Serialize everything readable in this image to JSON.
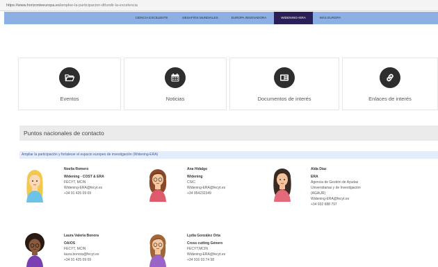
{
  "browser": {
    "url_host": "https://www.horizonteeuropa.es/",
    "url_path": "ampliar-la-participacion-difundir-la-excelencia"
  },
  "nav": {
    "items": [
      {
        "label": "CIENCIA EXCELENTE"
      },
      {
        "label": "DESAFÍOS MUNDIALES"
      },
      {
        "label": "EUROPA INNOVADORA"
      },
      {
        "label": "WIDENING+ERA"
      },
      {
        "label": "MÁS EUROPA"
      }
    ]
  },
  "cards": [
    {
      "label": "Eventos",
      "icon": "folder-open-icon"
    },
    {
      "label": "Noticias",
      "icon": "calendar-icon"
    },
    {
      "label": "Documentos de interés",
      "icon": "newspaper-icon"
    },
    {
      "label": "Enlaces de interés",
      "icon": "link-icon"
    }
  ],
  "section": {
    "title": "Puntos nacionales de contacto",
    "subtitle": "Ampliar la participación y fortalecer el espacio europeo de investigación (Widening-ERA)"
  },
  "contacts": [
    {
      "name": "Noelia Romero",
      "role": "Widening - COST & ERA",
      "lines": [
        "FECYT, MCIN",
        "Widening-ERA@fecyt.es",
        "+34 91 425 09 09"
      ]
    },
    {
      "name": "Ana Hidalgo",
      "role": "Widening",
      "lines": [
        "CSIC",
        "Widening-ERA@fecyt.es",
        "+34 954232349"
      ]
    },
    {
      "name": "Alda Díaz",
      "role": "ERA",
      "lines": [
        "Agencia de Gestión de Ayudas",
        "Universitarias y de Investigación",
        "(AGAUR)",
        "Widening-ERA@fecyt.es",
        "+34 932 688 797"
      ]
    },
    {
      "name": "Laura Valeria Bonora",
      "role": "OA/OS",
      "lines": [
        "FECYT, MCIN",
        "laura.bonora@fecyt.es",
        "+34 91 425 09 09"
      ]
    },
    {
      "name": "Lydia González Orta",
      "role": "Cross cutting Género",
      "lines": [
        "FECYT,MCIN",
        "Widening-ERA@fecyt.es",
        "+34 916 03 74 58"
      ]
    }
  ]
}
